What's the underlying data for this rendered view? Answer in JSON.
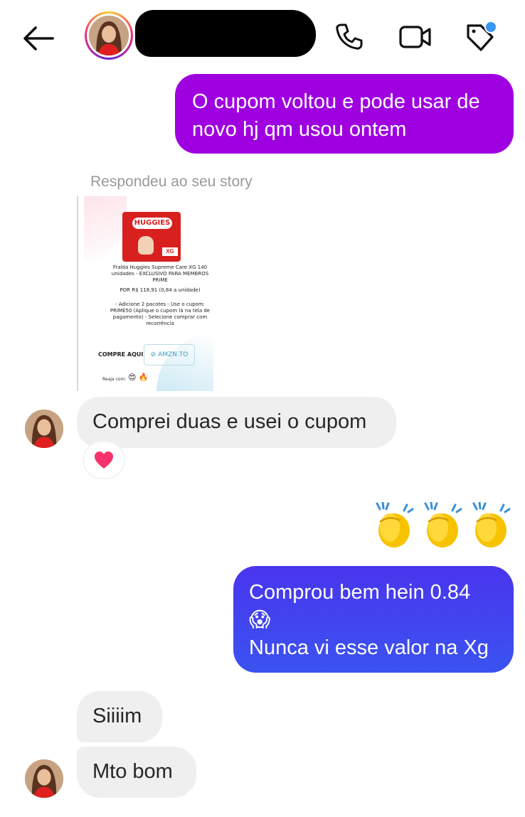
{
  "header": {
    "back_icon": "arrow-left-icon",
    "call_icon": "phone-icon",
    "video_icon": "video-camera-icon",
    "tag_icon": "tag-icon"
  },
  "messages": {
    "sent1": {
      "line1": "O cupom voltou e pode usar de",
      "line2": "novo hj qm usou ontem"
    },
    "story_reply_label": "Respondeu ao seu story",
    "story_card": {
      "brand": "HUGGIES",
      "size_tag": "XG",
      "title": "Fralda Huggies Supreme Care XG 140 unidades - EXCLUSIVO PARA MEMBROS PRIME",
      "price": "POR R$ 118,91 (0,84 a unidade)",
      "steps": "- Adicione 2 pacotes - Use o cupom: PRIME50 (Aplique o cupom lá na tela de pagamento) - Selecione comprar com recorrência",
      "cta": "COMPRE AQUI",
      "link": "AMZN.TO",
      "react_label": "Reaja com:"
    },
    "received1": "Comprei duas e usei o cupom",
    "reaction": "❤",
    "claps": "👏👏👏",
    "sent2": {
      "line1": "Comprou bem hein 0.84",
      "line2": "😱",
      "line3": "Nunca vi esse valor na Xg"
    },
    "received2": "Siiiim",
    "received3": "Mto bom"
  },
  "colors": {
    "sent_purple": "#9f00e0",
    "sent_blue": "#3f45ef",
    "received_bg": "#efefef",
    "notification_dot": "#3897f0"
  }
}
